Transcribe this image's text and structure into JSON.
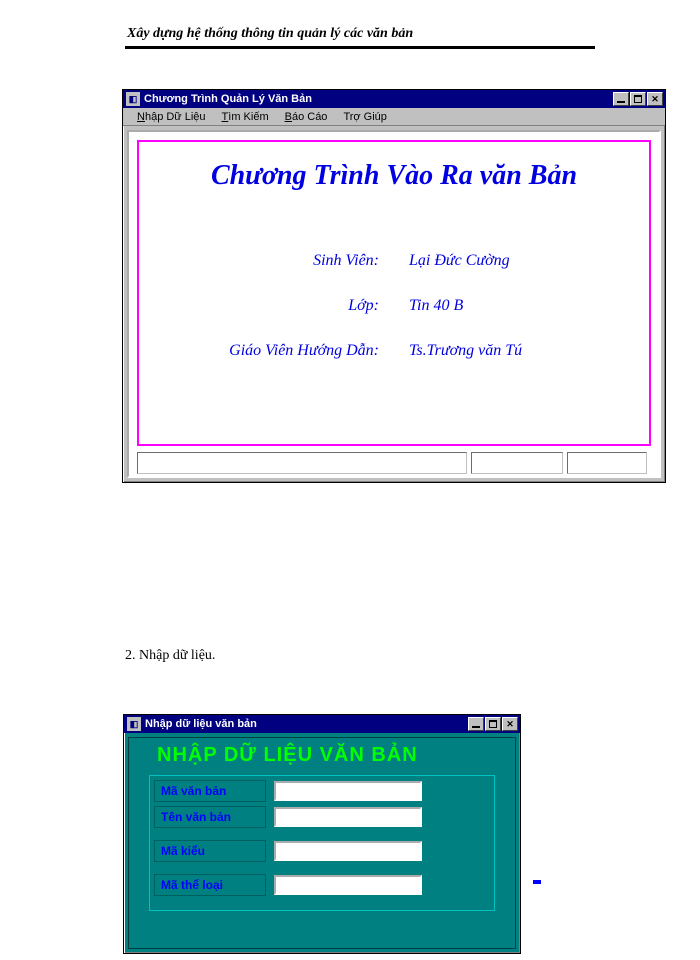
{
  "document": {
    "header": "Xây dựng hệ thống thông tin quản lý các văn bản",
    "section2": "2. Nhập dữ liệu."
  },
  "window1": {
    "title": "Chương Trình Quản Lý Văn Bản",
    "menu": {
      "item1": "Nhập Dữ Liệu",
      "item2": "Tìm Kiếm",
      "item3": "Báo Cáo",
      "item4": "Trợ Giúp"
    },
    "banner": "Chương Trình Vào Ra văn Bản",
    "fields": {
      "student_label": "Sinh Viên:",
      "student_value": "Lại Đức Cường",
      "class_label": "Lớp:",
      "class_value": "Tin 40 B",
      "teacher_label": "Giáo Viên Hướng Dẫn:",
      "teacher_value": "Ts.Trương văn Tú"
    }
  },
  "window2": {
    "title": "Nhập dữ liệu văn bản",
    "heading": "NHẬP DỮ LIỆU  VĂN BẢN",
    "fields": {
      "code_label": "Mã văn bản",
      "code_value": "",
      "name_label": "Tên văn bản",
      "name_value": "",
      "type_label": "Mã kiểu",
      "type_value": "",
      "category_label": "Mã thể loại",
      "category_value": ""
    }
  }
}
